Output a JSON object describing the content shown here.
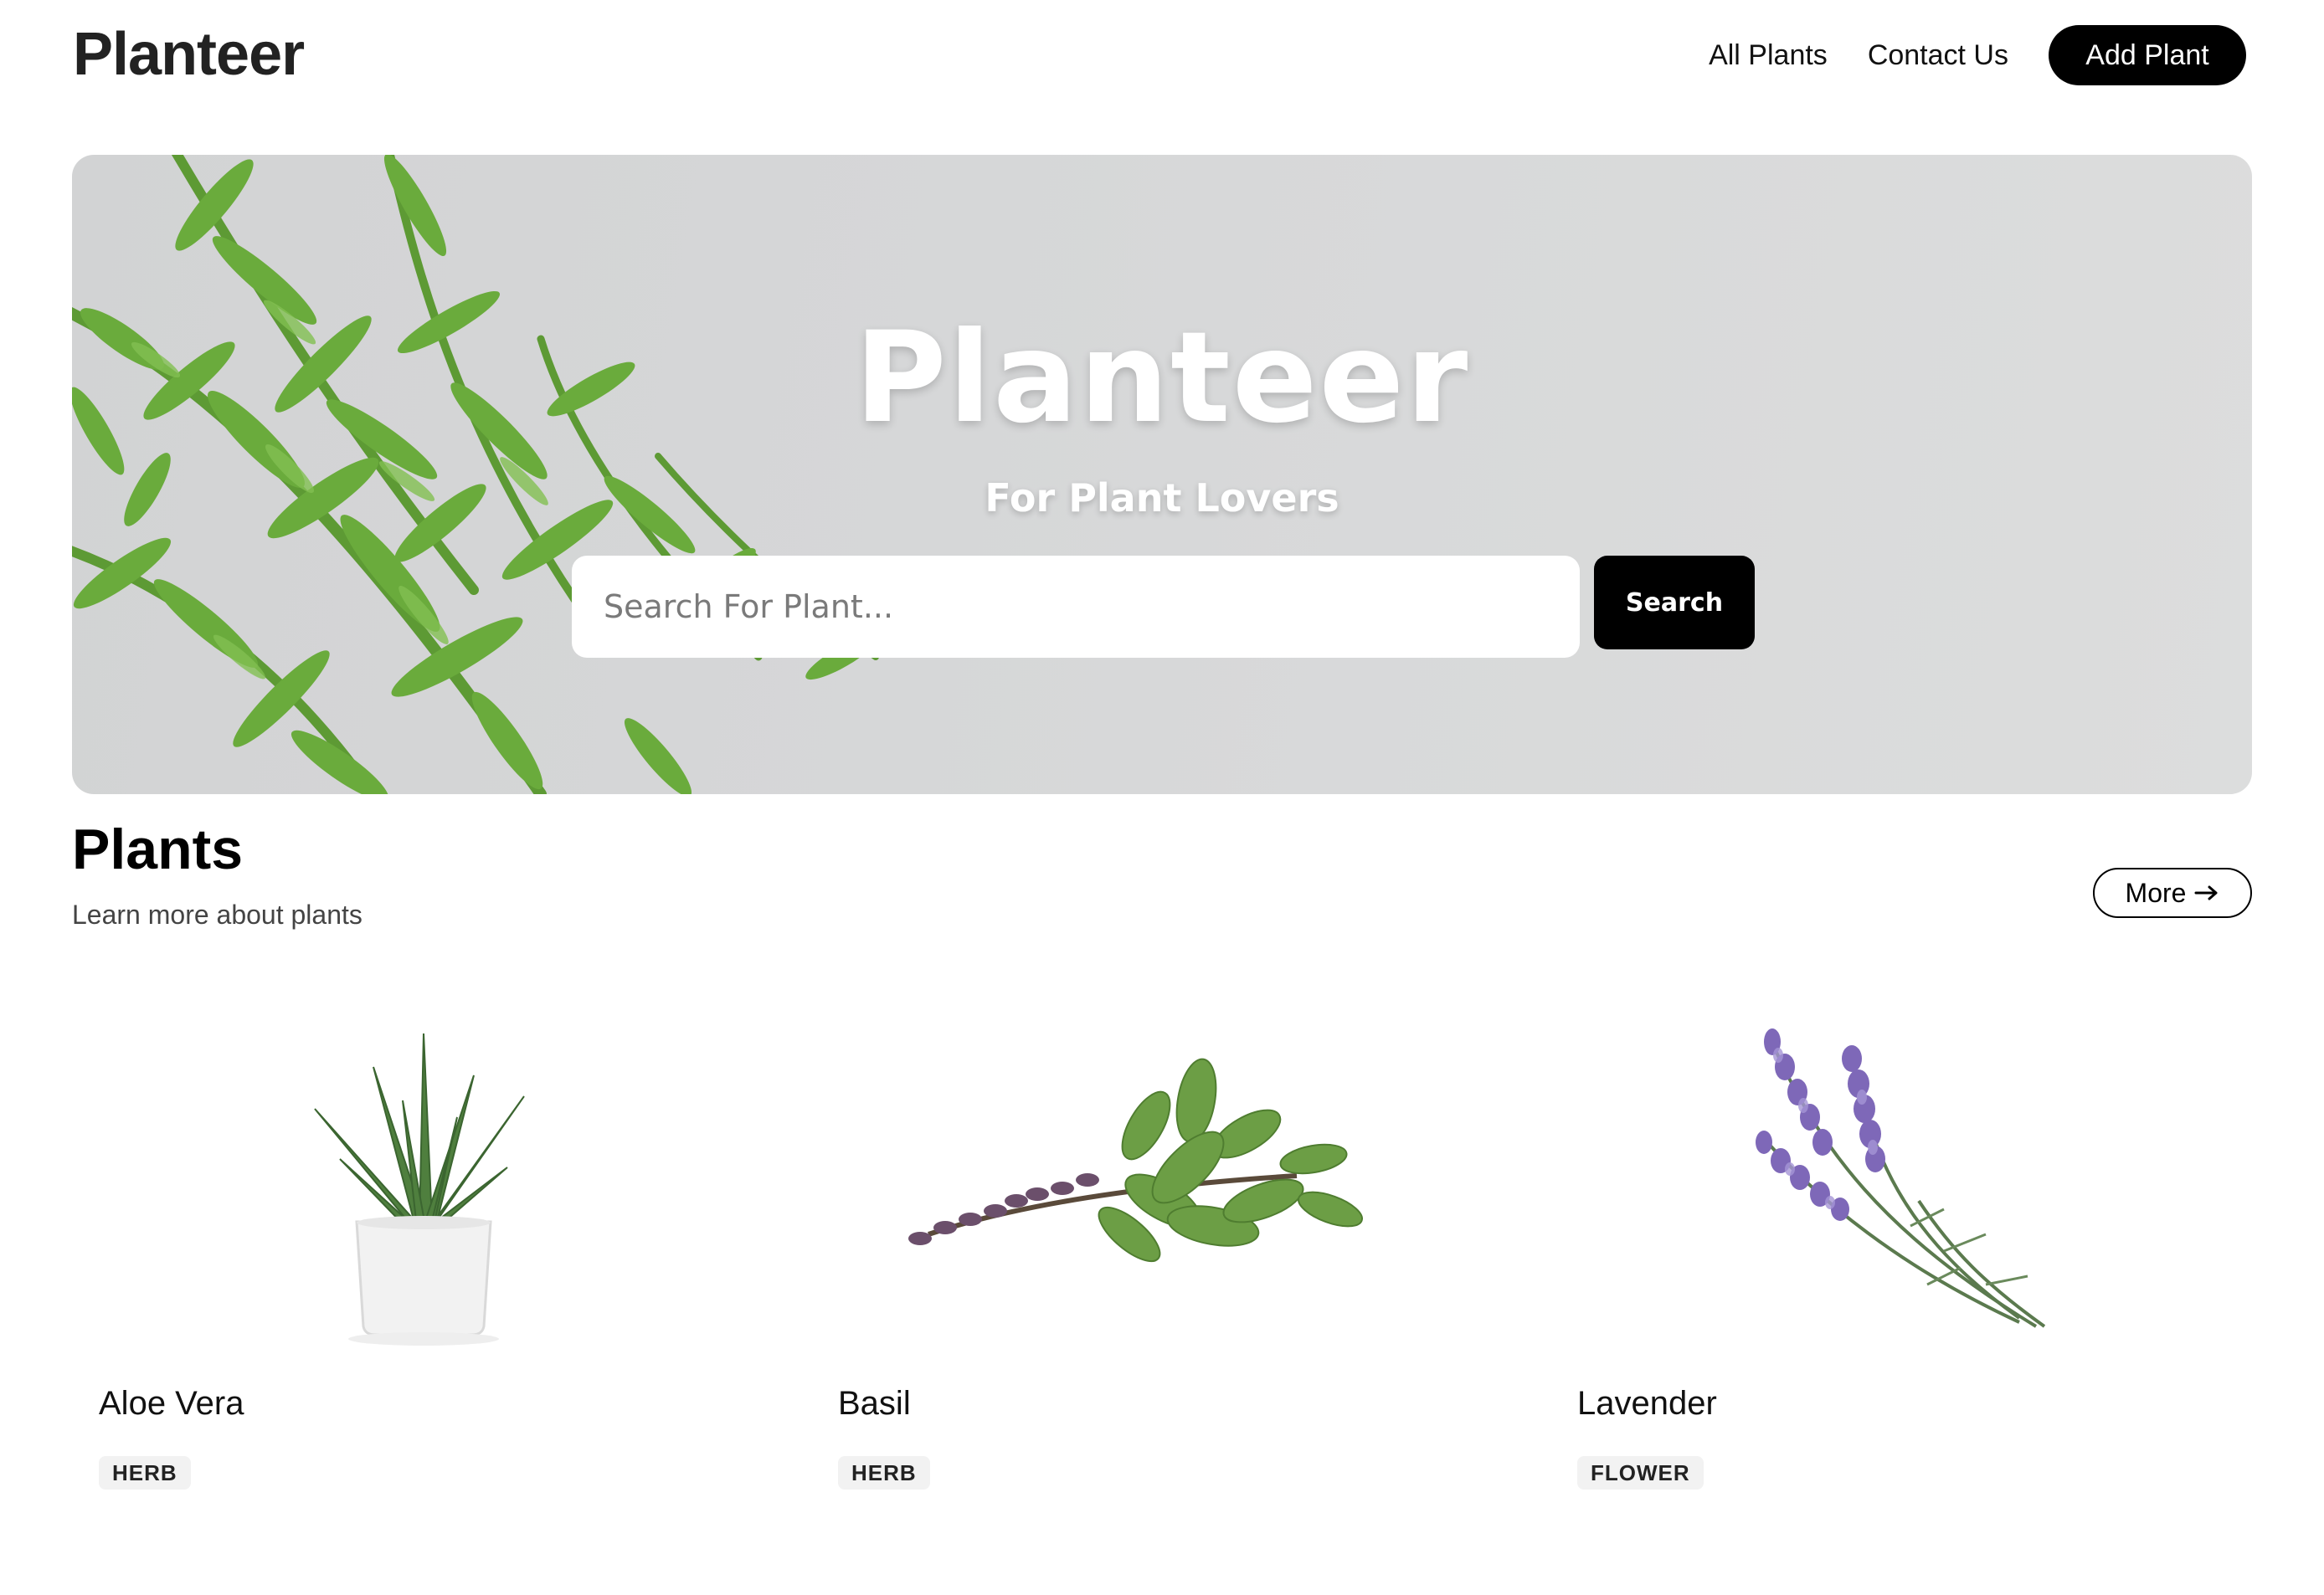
{
  "header": {
    "brand": "Planteer",
    "nav": [
      {
        "label": "All Plants"
      },
      {
        "label": "Contact Us"
      }
    ],
    "add_button": "Add Plant"
  },
  "hero": {
    "title": "Planteer",
    "subtitle": "For Plant Lovers",
    "search_placeholder": "Search For Plant...",
    "search_button": "Search"
  },
  "section": {
    "title": "Plants",
    "subtitle": "Learn more about plants",
    "more_button": "More",
    "more_icon": "arrow-right-icon"
  },
  "plants": [
    {
      "name": "Aloe Vera",
      "tag": "HERB"
    },
    {
      "name": "Basil",
      "tag": "HERB"
    },
    {
      "name": "Lavender",
      "tag": "FLOWER"
    }
  ]
}
